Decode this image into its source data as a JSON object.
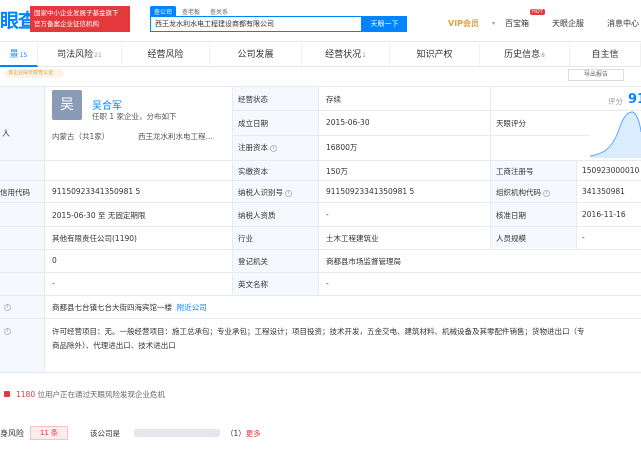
{
  "header": {
    "logo": "眼查",
    "badge_line1": "国家中小企业发展子基金旗下",
    "badge_line2": "官方备案企业征信机构",
    "search_tabs": [
      "查公司",
      "查老板",
      "查关系"
    ],
    "search_value": "西王龙水利水电工程建设商都有限公司",
    "search_button": "天眼一下",
    "vip": "VIP会员",
    "links": [
      "百宝箱",
      "天眼企服",
      "消息中心"
    ],
    "hot_badge": "HOT"
  },
  "tabs": [
    {
      "label": "景",
      "count": "15"
    },
    {
      "label": "司法风险",
      "count": "21"
    },
    {
      "label": "经营风险",
      "count": ""
    },
    {
      "label": "公司发展",
      "count": ""
    },
    {
      "label": "经营状况",
      "count": "1"
    },
    {
      "label": "知识产权",
      "count": ""
    },
    {
      "label": "历史信息",
      "count": "8"
    },
    {
      "label": "自主信",
      "count": ""
    }
  ],
  "strip": {
    "pill": "该企业由天眼查认证",
    "export": "导出报告"
  },
  "person": {
    "row_label": "人",
    "avatar_char": "吴",
    "name": "吴合军",
    "sub": "任职 1 家企业，分布如下",
    "location": "内蒙古（共1家）",
    "company": "西王龙水利水电工程..."
  },
  "score": {
    "label": "评分",
    "value": "91"
  },
  "rows": {
    "status_label": "经营状态",
    "status_value": "存续",
    "found_label": "成立日期",
    "found_value": "2015-06-30",
    "tianyan_label": "天眼评分",
    "capital_label": "注册资本",
    "capital_value": "16800万",
    "paid_label": "实缴资本",
    "paid_value": "150万",
    "reg_no_label": "工商注册号",
    "reg_no_value": "150923000010",
    "credit_label": "信用代码",
    "credit_value": "91150923341350981 5",
    "taxid_label": "纳税人识别号",
    "taxid_value": "91150923341350981 5",
    "org_label": "组织机构代码",
    "org_value": "341350981",
    "term_value": "2015-06-30 至 无固定期限",
    "taxq_label": "纳税人资质",
    "taxq_value": "-",
    "approve_label": "核准日期",
    "approve_value": "2016-11-16",
    "type_value": "其他有限责任公司(1190)",
    "industry_label": "行业",
    "industry_value": "土木工程建筑业",
    "staff_label": "人员规模",
    "staff_value": "-",
    "zero_value": "0",
    "authority_label": "登记机关",
    "authority_value": "商都县市场监督管理局",
    "dash_value": "-",
    "en_label": "英文名称",
    "en_value": "-",
    "address_value": "商都县七台镇七台大街四海宾馆一楼",
    "address_link": "附近公司",
    "scope_line1": "许可经营项目：无。一般经营项目：施工总承包；专业承包；工程设计；项目投资；技术开发，五金交电、建筑材料、机械设备及其零配件销售；货物进出口（专",
    "scope_line2": "商品除外）、代理进出口、技术进出口"
  },
  "alert": {
    "count": "1180",
    "text": "位用户正在通过天眼风险发现企业危机"
  },
  "risk": {
    "label": "身风险",
    "badge": "11 条",
    "text": "该公司是",
    "count": "（1）",
    "more": "更多"
  }
}
